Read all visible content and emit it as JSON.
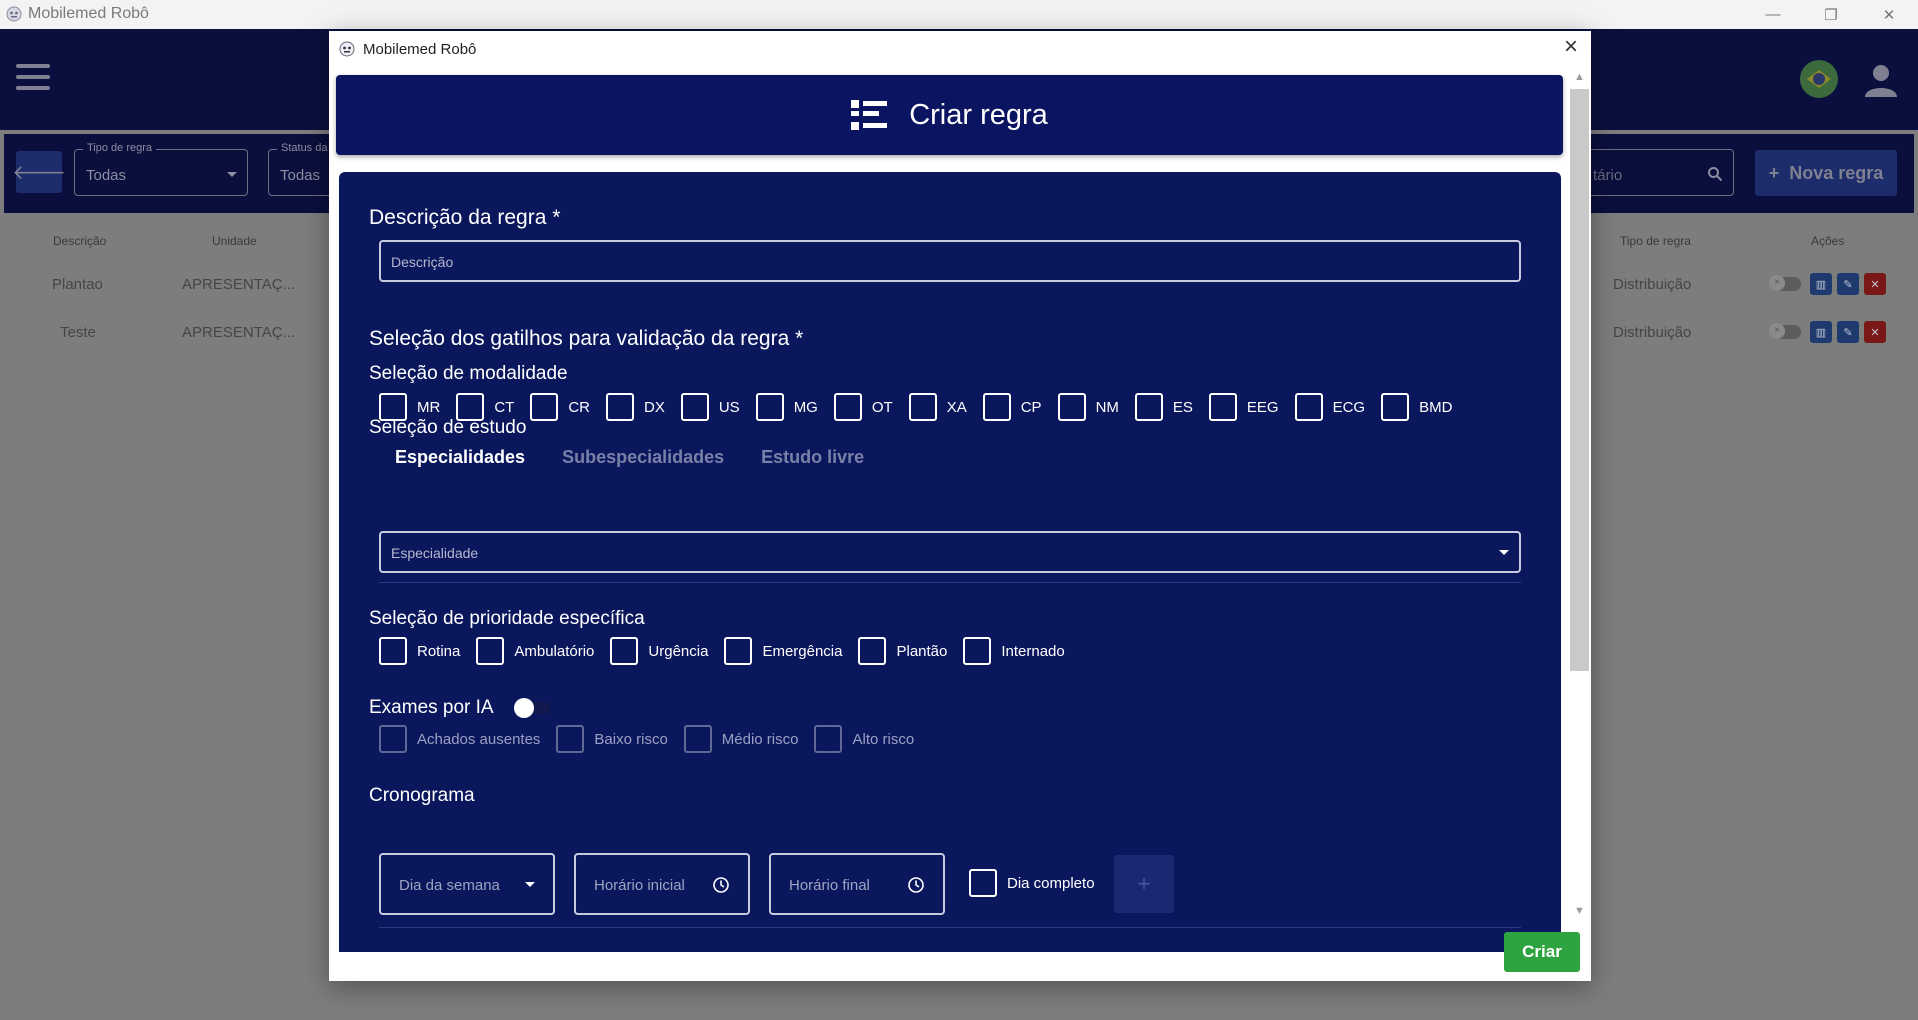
{
  "window": {
    "title": "Mobilemed Robô",
    "minimize_glyph": "—",
    "restore_glyph": "❐",
    "close_glyph": "✕"
  },
  "filters": {
    "rule_type": {
      "label": "Tipo de regra",
      "value": "Todas"
    },
    "status": {
      "label": "Status da",
      "value": "Todas"
    },
    "search": {
      "value": "tário"
    },
    "new_rule_label": "Nova regra"
  },
  "table": {
    "headers": {
      "description": "Descrição",
      "unit": "Unidade",
      "rule_type": "Tipo de regra",
      "actions": "Ações"
    },
    "rows": [
      {
        "description": "Plantao",
        "unit": "APRESENTAÇ...",
        "rule_type": "Distribuição"
      },
      {
        "description": "Teste",
        "unit": "APRESENTAÇ...",
        "rule_type": "Distribuição"
      }
    ]
  },
  "dialog": {
    "title": "Mobilemed Robô",
    "header_title": "Criar regra",
    "description": {
      "section_title": "Descrição da regra *",
      "placeholder": "Descrição"
    },
    "triggers_title": "Seleção dos gatilhos para validação da regra *",
    "modality": {
      "title": "Seleção de modalidade",
      "options": [
        "MR",
        "CT",
        "CR",
        "DX",
        "US",
        "MG",
        "OT",
        "XA",
        "CP",
        "NM",
        "ES",
        "EEG",
        "ECG",
        "BMD"
      ]
    },
    "study": {
      "title": "Seleção de estudo",
      "tabs": [
        "Especialidades",
        "Subespecialidades",
        "Estudo livre"
      ],
      "active_tab": "Especialidades",
      "specialty_placeholder": "Especialidade"
    },
    "priority": {
      "title": "Seleção de prioridade específica",
      "options": [
        "Rotina",
        "Ambulatório",
        "Urgência",
        "Emergência",
        "Plantão",
        "Internado"
      ]
    },
    "ia": {
      "title": "Exames por IA",
      "enabled": false,
      "options": [
        "Achados ausentes",
        "Baixo risco",
        "Médio risco",
        "Alto risco"
      ]
    },
    "schedule": {
      "title": "Cronograma",
      "weekday_placeholder": "Dia da semana",
      "start_placeholder": "Horário inicial",
      "end_placeholder": "Horário final",
      "full_day_label": "Dia completo",
      "add_glyph": "+"
    },
    "create_label": "Criar"
  },
  "colors": {
    "navy": "#0a0f3d",
    "form_panel": "#0b175c",
    "accent_green": "#2ea441"
  }
}
